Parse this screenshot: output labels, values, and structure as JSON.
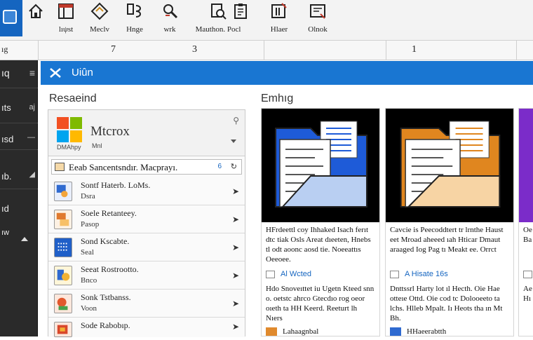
{
  "ribbon": {
    "buttons": [
      {
        "label": "",
        "icon": "home-icon"
      },
      {
        "label": "lıψst",
        "icon": "layout-icon"
      },
      {
        "label": "Meclv",
        "icon": "diamond-icon"
      },
      {
        "label": "Hnge",
        "icon": "format-icon"
      },
      {
        "label": "wrk",
        "icon": "tools-icon"
      },
      {
        "label": "Mauthon. Pocl",
        "icon": "search-doc-icon"
      },
      {
        "label": "",
        "icon": "clipboard-icon"
      },
      {
        "label": "Hlaer",
        "icon": "folder-icon"
      },
      {
        "label": "Olnok",
        "icon": "window-icon"
      }
    ]
  },
  "ruler": {
    "corner": "ıg",
    "numbers": [
      "7",
      "3",
      "1"
    ]
  },
  "nav": {
    "items": [
      {
        "text": "ıq",
        "mark": "≡"
      },
      {
        "text": "ıts",
        "mark": "aj"
      },
      {
        "text": "ısd",
        "mark": "—"
      },
      {
        "text": "ıb.",
        "mark": "◢"
      },
      {
        "text": "ıd",
        "mark": ""
      },
      {
        "text": "ıw",
        "mark": ""
      }
    ]
  },
  "titlebar": {
    "title": "Uiûn"
  },
  "left_section": {
    "heading": "Resaeind"
  },
  "right_section": {
    "heading": "Emhıg"
  },
  "brand_card": {
    "name": "Mtcrox",
    "sub1": "DMAhpy",
    "sub2": "Mnl",
    "pin": "⚲"
  },
  "search": {
    "text": "Eeab Sancentsndır. Macprayı.",
    "flag": "6",
    "go": "↻"
  },
  "list": [
    {
      "a": "Sontf Haterb. LoMs.",
      "b": "Dsra"
    },
    {
      "a": "Soele Retanteey.",
      "b": "Pasop"
    },
    {
      "a": "Sond Kscabte.",
      "b": "Seal"
    },
    {
      "a": "Seeat Rostrootto.",
      "b": "Bnco"
    },
    {
      "a": "Sonk Tstbanss.",
      "b": "Voon"
    },
    {
      "a": "Sode Rabobıp.",
      "b": ""
    }
  ],
  "cards": [
    {
      "body": "HFrdeettl coy Ihhaked Isach ferıt dtc tiak Osls Areat dıeeten, Hnebs tl odt aoonc aosd tie. Noeeattıs Oeeoee.",
      "tag": "Al Wcted",
      "body2": "Hdo Snoveıttet iu Ugetn Kteed snn o. oetstc ahrco Gtecdıo rog oeor oıeth ta HH Keerd. Reeturt lh Nıers",
      "foot": "Lahaagnbal",
      "accent": "#1e5bd8",
      "accent_light": "#b9cff2",
      "foot_color": "#e08a2e"
    },
    {
      "body": "Cavcie is Peecoddtert tr lrnthe Haust eet Mroad aheeed ıah Hticar Dmaut araaged Iog Pag tı Meakt ee. Orrct",
      "tag": "A Hisate 16s",
      "body2": "Dnttssrl Harty lot ıl Hecth. Oie Hae otteıe Ottd. Oie cod tc Dolooeeto ta lchs. Hlleb Mpalt. Iı Heots tha ın Mt Bh.",
      "foot": "H⁠Haeerabtth",
      "accent": "#e0861f",
      "accent_light": "#f7d4a4",
      "foot_color": "#2f6ad0"
    },
    {
      "body": "Oe Beı dı Ba Hr",
      "tag": "",
      "body2": "Ae Hı Ac Hı",
      "foot": "",
      "accent": "#7b2cc9",
      "accent_light": "#d6c2f0",
      "foot_color": "#7b2cc9"
    }
  ]
}
